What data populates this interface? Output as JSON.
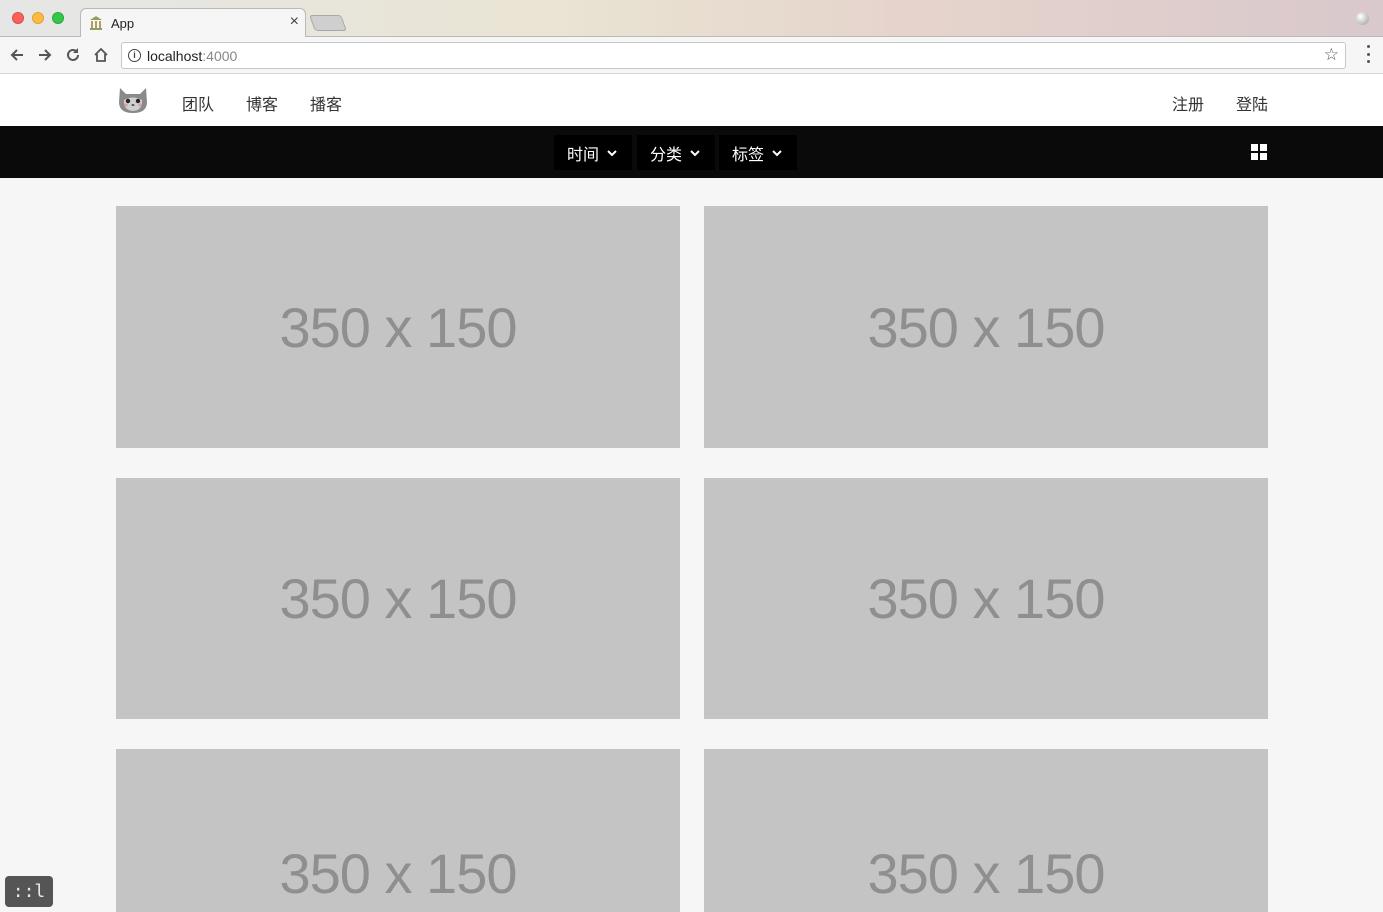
{
  "browser": {
    "tab_title": "App",
    "url_host": "localhost",
    "url_port": ":4000"
  },
  "header": {
    "nav": [
      "团队",
      "博客",
      "播客"
    ],
    "register": "注册",
    "login": "登陆"
  },
  "filters": [
    {
      "label": "时间"
    },
    {
      "label": "分类"
    },
    {
      "label": "标签"
    }
  ],
  "cards": [
    {
      "placeholder": "350 x 150"
    },
    {
      "placeholder": "350 x 150"
    },
    {
      "placeholder": "350 x 150"
    },
    {
      "placeholder": "350 x 150"
    },
    {
      "placeholder": "350 x 150"
    },
    {
      "placeholder": "350 x 150"
    }
  ],
  "debug_badge": "::l",
  "colors": {
    "filterbar_bg": "#0a0a0a",
    "card_bg": "#c4c4c4",
    "page_bg": "#f6f6f6"
  }
}
